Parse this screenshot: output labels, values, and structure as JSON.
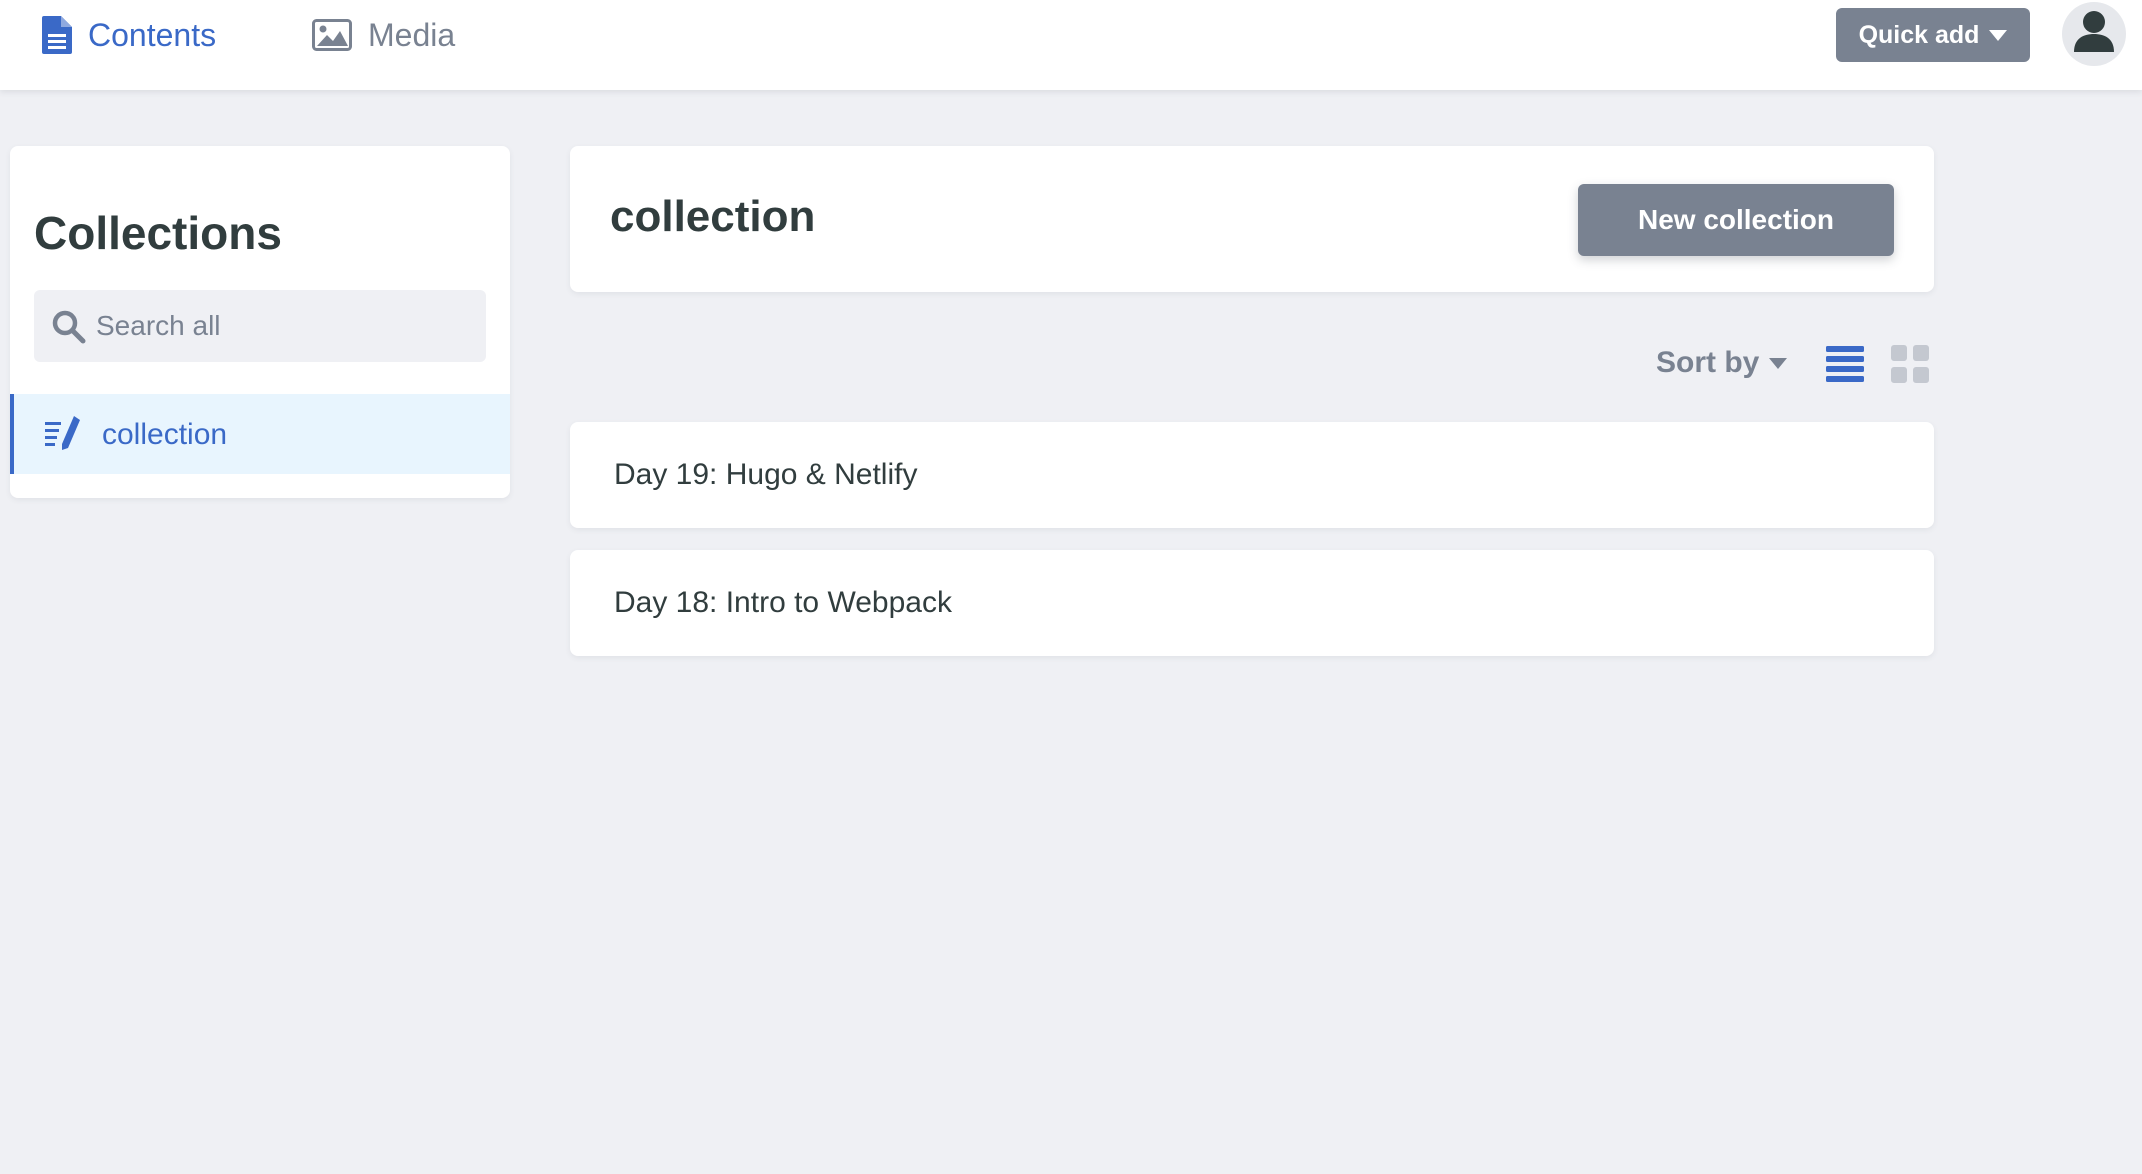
{
  "topbar": {
    "nav": [
      {
        "label": "Contents",
        "icon": "document-icon",
        "active": true
      },
      {
        "label": "Media",
        "icon": "image-icon",
        "active": false
      }
    ],
    "quick_add_label": "Quick add",
    "avatar_icon": "user-icon"
  },
  "sidebar": {
    "title": "Collections",
    "search": {
      "placeholder": "Search all",
      "value": ""
    },
    "items": [
      {
        "label": "collection",
        "icon": "write-icon",
        "active": true
      }
    ]
  },
  "main": {
    "title": "collection",
    "new_button_label": "New collection",
    "toolbar": {
      "sort_label": "Sort by",
      "view_modes": [
        {
          "name": "list-view-icon",
          "active": true
        },
        {
          "name": "grid-view-icon",
          "active": false
        }
      ]
    },
    "entries": [
      {
        "title": "Day 19: Hugo & Netlify"
      },
      {
        "title": "Day 18: Intro to Webpack"
      }
    ]
  },
  "colors": {
    "accent": "#3a69c7",
    "muted": "#798291",
    "background": "#eff0f4",
    "text": "#313d3e",
    "active_bg": "#e8f5fe"
  }
}
